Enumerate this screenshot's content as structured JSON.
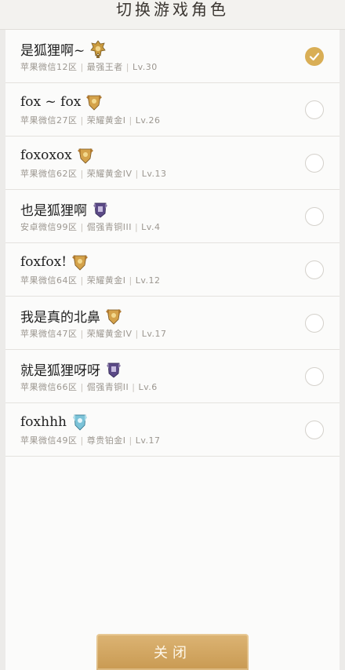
{
  "header": {
    "title": "切换游戏角色"
  },
  "accent_color": "#d9ae55",
  "roles": [
    {
      "name": "是狐狸啊~",
      "server": "苹果微信12区",
      "rank": "最强王者",
      "level": "Lv.30",
      "badge": "king-rank-icon",
      "selected": true
    },
    {
      "name": "fox ~ fox",
      "server": "苹果微信27区",
      "rank": "荣耀黄金I",
      "level": "Lv.26",
      "badge": "gold-rank-icon",
      "selected": false
    },
    {
      "name": "foxoxox",
      "server": "苹果微信62区",
      "rank": "荣耀黄金IV",
      "level": "Lv.13",
      "badge": "gold-rank-icon",
      "selected": false
    },
    {
      "name": "也是狐狸啊",
      "server": "安卓微信99区",
      "rank": "倔强青铜III",
      "level": "Lv.4",
      "badge": "bronze-rank-icon",
      "selected": false
    },
    {
      "name": "foxfox!",
      "server": "苹果微信64区",
      "rank": "荣耀黄金I",
      "level": "Lv.12",
      "badge": "gold-rank-icon",
      "selected": false
    },
    {
      "name": "我是真的北鼻",
      "server": "苹果微信47区",
      "rank": "荣耀黄金IV",
      "level": "Lv.17",
      "badge": "gold-rank-icon",
      "selected": false
    },
    {
      "name": "就是狐狸呀呀",
      "server": "苹果微信66区",
      "rank": "倔强青铜II",
      "level": "Lv.6",
      "badge": "bronze-rank-icon",
      "selected": false
    },
    {
      "name": "foxhhh",
      "server": "苹果微信49区",
      "rank": "尊贵铂金I",
      "level": "Lv.17",
      "badge": "platinum-rank-icon",
      "selected": false
    }
  ],
  "footer": {
    "close_label": "关闭"
  }
}
